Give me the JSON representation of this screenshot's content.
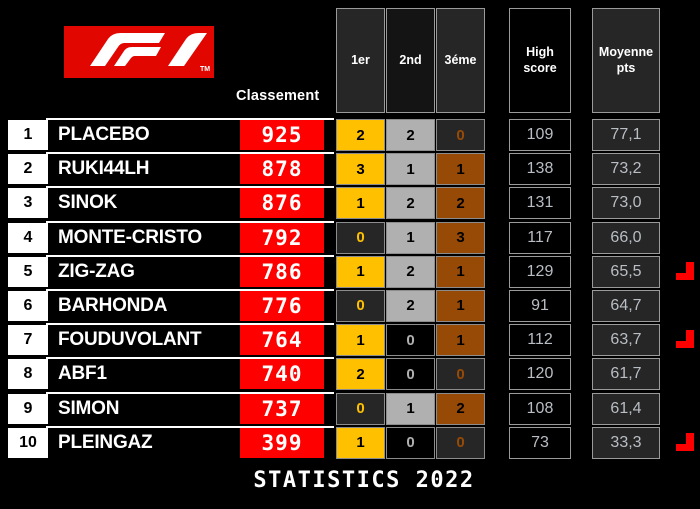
{
  "board": {
    "logo_alt": "f1-logo",
    "classement_label": "Classement",
    "footer_title": "STATISTICS 2022"
  },
  "colors": {
    "brand_red": "#E10600",
    "score_red": "#FF0000",
    "gold": "#FFC000",
    "silver": "#B0B0B0",
    "bronze": "#974A06",
    "zero_bg_gold": "#262626",
    "zero_bg_silver": "#000000",
    "zero_bg_bronze": "#262626",
    "marker_red": "#FF0000",
    "header_bg": "#262626",
    "stat_text": "#b9bec4"
  },
  "header": {
    "columns": [
      {
        "key": "first",
        "label": "1er"
      },
      {
        "key": "second",
        "label": "2nd"
      },
      {
        "key": "third",
        "label": "3éme"
      },
      {
        "key": "high",
        "label": "High score"
      },
      {
        "key": "avg",
        "label": "Moyenne pts"
      }
    ]
  },
  "table": {
    "rows": [
      {
        "rank": "1",
        "name": "PLACEBO",
        "score": "925",
        "first": "2",
        "second": "2",
        "third": "0",
        "high": "109",
        "avg": "77,1",
        "marker": false
      },
      {
        "rank": "2",
        "name": "RUKI44LH",
        "score": "878",
        "first": "3",
        "second": "1",
        "third": "1",
        "high": "138",
        "avg": "73,2",
        "marker": false
      },
      {
        "rank": "3",
        "name": "SINOK",
        "score": "876",
        "first": "1",
        "second": "2",
        "third": "2",
        "high": "131",
        "avg": "73,0",
        "marker": false
      },
      {
        "rank": "4",
        "name": "MONTE-CRISTO",
        "score": "792",
        "first": "0",
        "second": "1",
        "third": "3",
        "high": "117",
        "avg": "66,0",
        "marker": false
      },
      {
        "rank": "5",
        "name": "ZIG-ZAG",
        "score": "786",
        "first": "1",
        "second": "2",
        "third": "1",
        "high": "129",
        "avg": "65,5",
        "marker": true
      },
      {
        "rank": "6",
        "name": "BARHONDA",
        "score": "776",
        "first": "0",
        "second": "2",
        "third": "1",
        "high": "91",
        "avg": "64,7",
        "marker": false
      },
      {
        "rank": "7",
        "name": "FOUDUVOLANT",
        "score": "764",
        "first": "1",
        "second": "0",
        "third": "1",
        "high": "112",
        "avg": "63,7",
        "marker": true
      },
      {
        "rank": "8",
        "name": "ABF1",
        "score": "740",
        "first": "2",
        "second": "0",
        "third": "0",
        "high": "120",
        "avg": "61,7",
        "marker": false
      },
      {
        "rank": "9",
        "name": "SIMON",
        "score": "737",
        "first": "0",
        "second": "1",
        "third": "2",
        "high": "108",
        "avg": "61,4",
        "marker": false
      },
      {
        "rank": "10",
        "name": "PLEINGAZ",
        "score": "399",
        "first": "1",
        "second": "0",
        "third": "0",
        "high": "73",
        "avg": "33,3",
        "marker": true
      }
    ]
  }
}
